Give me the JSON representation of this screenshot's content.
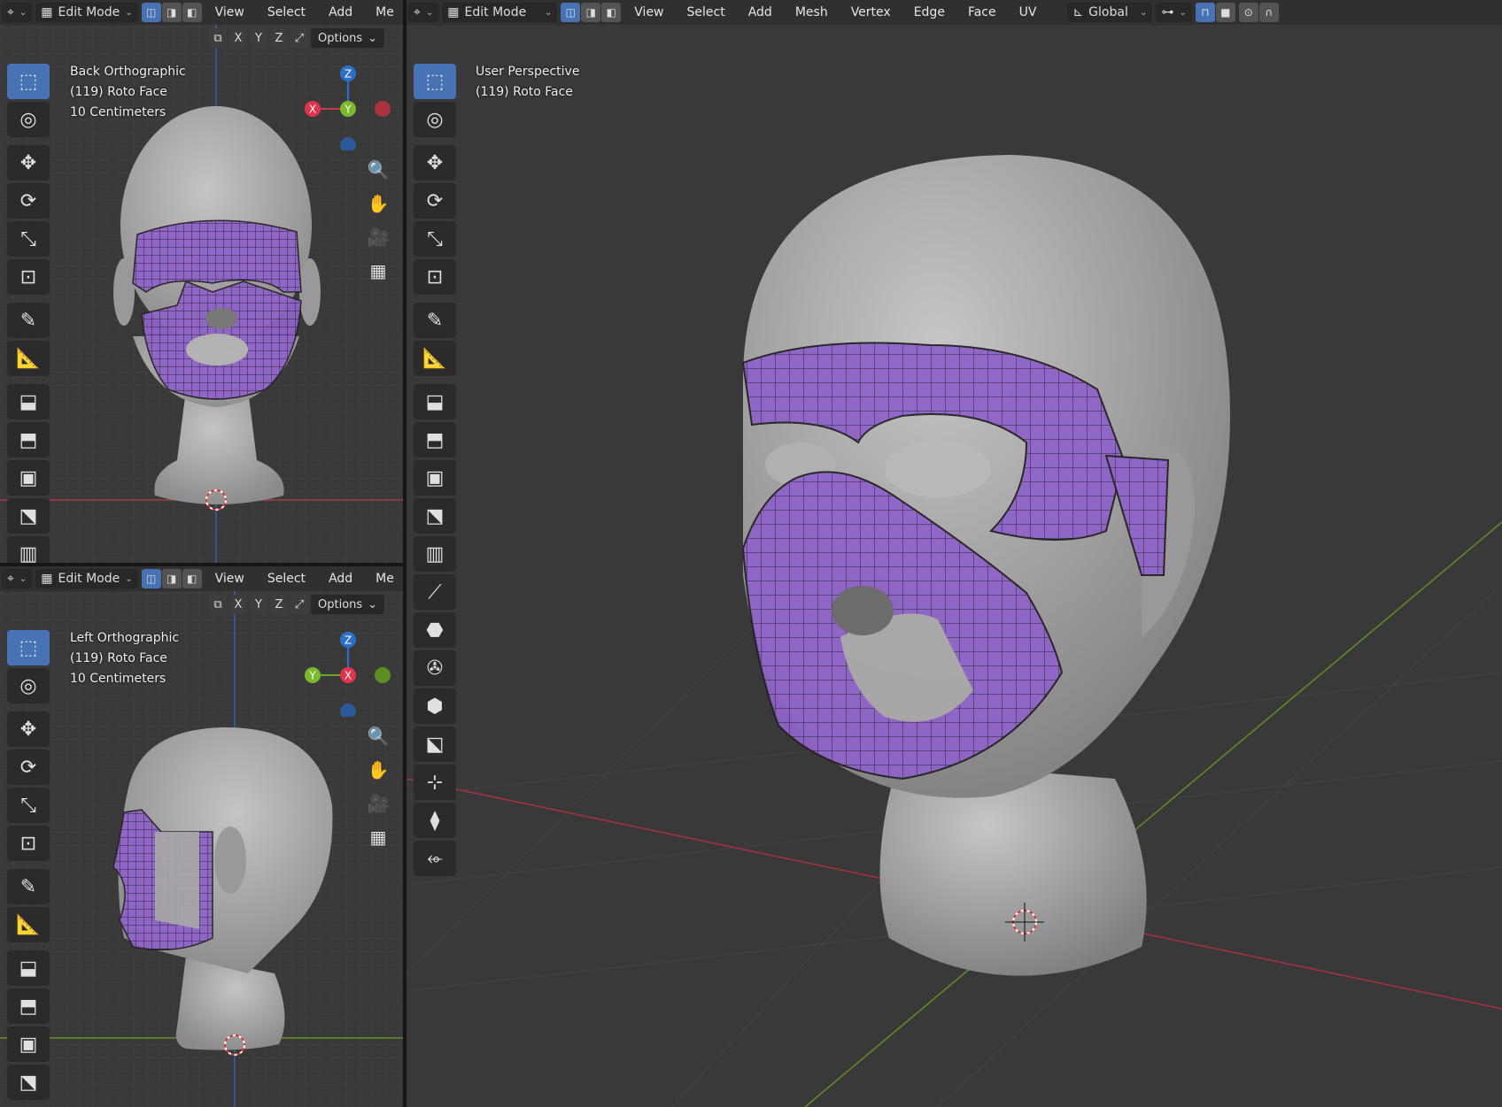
{
  "editors": {
    "top_left": {
      "mode": "Edit Mode",
      "menus": [
        "View",
        "Select",
        "Add",
        "Me"
      ],
      "axis_buttons": [
        "X",
        "Y",
        "Z"
      ],
      "options_label": "Options",
      "view_name": "Back Orthographic",
      "object": "(119) Roto Face",
      "scale": "10 Centimeters",
      "gizmo_axes": [
        "Z",
        "X",
        "Y"
      ]
    },
    "bottom_left": {
      "mode": "Edit Mode",
      "menus": [
        "View",
        "Select",
        "Add",
        "Me"
      ],
      "axis_buttons": [
        "X",
        "Y",
        "Z"
      ],
      "options_label": "Options",
      "view_name": "Left Orthographic",
      "object": "(119) Roto Face",
      "scale": "10 Centimeters",
      "gizmo_axes": [
        "Z",
        "Y",
        "X"
      ]
    },
    "main": {
      "mode": "Edit Mode",
      "menus": [
        "View",
        "Select",
        "Add",
        "Mesh",
        "Vertex",
        "Edge",
        "Face",
        "UV"
      ],
      "orientation": "Global",
      "view_name": "User Perspective",
      "object": "(119) Roto Face"
    }
  },
  "colors": {
    "accent": "#4772b3",
    "mesh_face": "#8f63c8",
    "mesh_wire": "#222222",
    "x_axis": "#c43c4c",
    "y_axis": "#6aa525",
    "z_axis": "#2b6fc9",
    "head": "#a9a9a9"
  },
  "icons": {
    "tools": [
      "select-box-icon",
      "cursor-icon",
      "move-icon",
      "rotate-icon",
      "scale-icon",
      "transform-icon",
      "annotate-icon",
      "measure-icon",
      "add-cube-icon",
      "extrude-icon",
      "inset-icon",
      "bevel-icon",
      "loop-cut-icon",
      "knife-icon",
      "poly-build-icon",
      "spin-icon",
      "smooth-icon",
      "edge-slide-icon",
      "shrink-fatten-icon",
      "shear-icon",
      "rip-icon"
    ],
    "nav": [
      "zoom-icon",
      "pan-hand-icon",
      "camera-icon",
      "grid-icon"
    ]
  }
}
